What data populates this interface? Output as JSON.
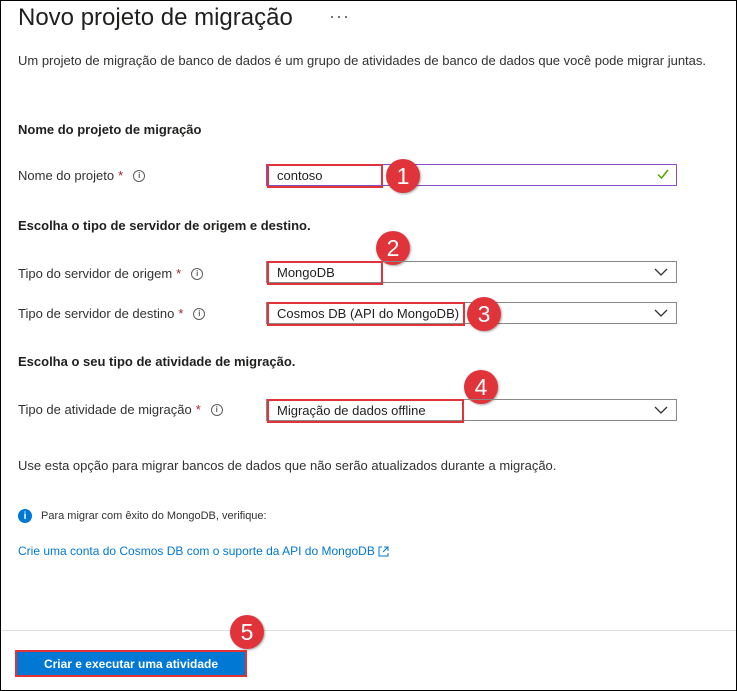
{
  "header": {
    "title": "Novo projeto de migração",
    "more_label": "···"
  },
  "description": "Um projeto de migração de banco de dados é um grupo de atividades de banco de dados que você pode migrar juntas.",
  "sections": {
    "project_name": "Nome do projeto de migração",
    "server_types": "Escolha o tipo de servidor de origem e destino.",
    "activity_type": "Escolha o seu tipo de atividade de migração."
  },
  "fields": {
    "project_name": {
      "label": "Nome do projeto",
      "required_mark": "*",
      "value": "contoso"
    },
    "source_server": {
      "label": "Tipo do servidor de origem",
      "required_mark": "*",
      "value": "MongoDB"
    },
    "target_server": {
      "label": "Tipo de servidor de destino",
      "required_mark": "*",
      "value": "Cosmos DB (API do MongoDB)"
    },
    "activity": {
      "label": "Tipo de atividade de migração",
      "required_mark": "*",
      "value": "Migração de dados offline"
    }
  },
  "hint": "Use esta opção para migrar bancos de dados que não serão atualizados durante a migração.",
  "info_note": "Para migrar com êxito do MongoDB, verifique:",
  "link": "Crie uma conta do Cosmos DB com o suporte da API do MongoDB",
  "footer": {
    "primary_button": "Criar e executar uma atividade"
  },
  "callouts": [
    "1",
    "2",
    "3",
    "4",
    "5"
  ],
  "colors": {
    "accent": "#0078d4",
    "callout": "#e0333a",
    "required": "#a4262c",
    "valid_check": "#57a300"
  },
  "icons": [
    "info-icon",
    "checkmark-icon",
    "chevron-down-icon",
    "external-link-icon",
    "more-icon"
  ]
}
